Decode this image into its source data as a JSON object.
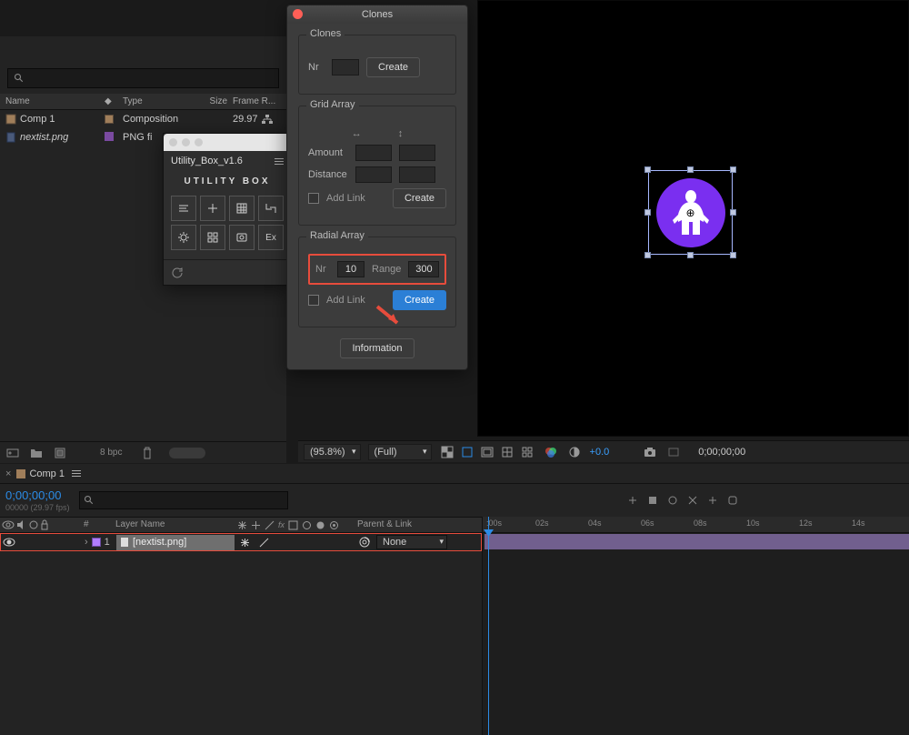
{
  "project": {
    "headers": {
      "name": "Name",
      "tag": "◆",
      "type": "Type",
      "size": "Size",
      "frame": "Frame R..."
    },
    "rows": [
      {
        "name": "Comp 1",
        "type": "Composition",
        "size": "",
        "frame": "29.97"
      },
      {
        "name": "nextist.png",
        "type": "PNG fi",
        "size": "",
        "frame": ""
      }
    ],
    "bpc": "8 bpc"
  },
  "utilityBox": {
    "title": "Utility_Box_v1.6",
    "logo": "UTILITY BOX",
    "btn8": "Ex"
  },
  "clones": {
    "title": "Clones",
    "sec1": {
      "legend": "Clones",
      "nr": "Nr",
      "create": "Create"
    },
    "sec2": {
      "legend": "Grid Array",
      "amount": "Amount",
      "distance": "Distance",
      "addlink": "Add Link",
      "create": "Create"
    },
    "sec3": {
      "legend": "Radial Array",
      "nr": "Nr",
      "nr_v": "10",
      "range": "Range",
      "range_v": "300",
      "addlink": "Add Link",
      "create": "Create"
    },
    "info": "Information"
  },
  "previewFooter": {
    "zoom": "(95.8%)",
    "res": "(Full)",
    "plus": "+0.0",
    "time": "0;00;00;00"
  },
  "timeline": {
    "tab": "Comp 1",
    "timecode": "0;00;00;00",
    "timecode_sub": "00000 (29.97 fps)",
    "cols": {
      "idx": "#",
      "name": "Layer Name",
      "parent": "Parent & Link"
    },
    "layer": {
      "idx": "1",
      "name": "[nextist.png]",
      "parent": "None"
    },
    "ruler_start": ":00s",
    "marks": [
      "02s",
      "04s",
      "06s",
      "08s",
      "10s",
      "12s",
      "14s"
    ]
  }
}
